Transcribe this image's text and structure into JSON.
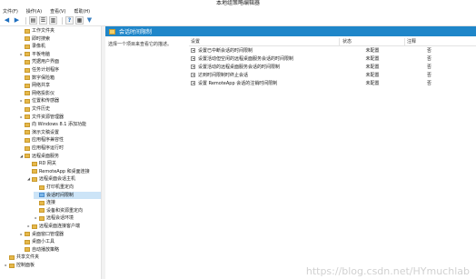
{
  "window": {
    "title": "本地组策略编辑器"
  },
  "menu": [
    "文件(F)",
    "操作(A)",
    "查看(V)",
    "帮助(H)"
  ],
  "tree": [
    {
      "label": "工作文件夹",
      "level": 0,
      "expander": ""
    },
    {
      "label": "即时搜索",
      "level": 0,
      "expander": ""
    },
    {
      "label": "录像机",
      "level": 0,
      "expander": ""
    },
    {
      "label": "平板电脑",
      "level": 0,
      "expander": "▸"
    },
    {
      "label": "凭据用户界面",
      "level": 0,
      "expander": ""
    },
    {
      "label": "任务计划程序",
      "level": 0,
      "expander": ""
    },
    {
      "label": "数字保险箱",
      "level": 0,
      "expander": ""
    },
    {
      "label": "网络共享",
      "level": 0,
      "expander": ""
    },
    {
      "label": "网络投影仪",
      "level": 0,
      "expander": ""
    },
    {
      "label": "位置和传感器",
      "level": 0,
      "expander": "▸"
    },
    {
      "label": "文件历史",
      "level": 0,
      "expander": ""
    },
    {
      "label": "文件资源管理器",
      "level": 0,
      "expander": "▸"
    },
    {
      "label": "向 Windows 8.1 添加功能",
      "level": 0,
      "expander": ""
    },
    {
      "label": "演示文稿设置",
      "level": 0,
      "expander": ""
    },
    {
      "label": "应用程序兼容性",
      "level": 0,
      "expander": ""
    },
    {
      "label": "应用程序运行时",
      "level": 0,
      "expander": ""
    },
    {
      "label": "远程桌面服务",
      "level": 0,
      "expander": "◢"
    },
    {
      "label": "RD 网关",
      "level": 1,
      "expander": ""
    },
    {
      "label": "RemoteApp 和桌面连接",
      "level": 1,
      "expander": ""
    },
    {
      "label": "远程桌面会话主机",
      "level": 1,
      "expander": "◢"
    },
    {
      "label": "打印机重定向",
      "level": 2,
      "expander": ""
    },
    {
      "label": "会话时间限制",
      "level": 2,
      "expander": "",
      "selected": true
    },
    {
      "label": "连接",
      "level": 2,
      "expander": ""
    },
    {
      "label": "设备和资源重定向",
      "level": 2,
      "expander": ""
    },
    {
      "label": "远程会话环境",
      "level": 2,
      "expander": "▸"
    },
    {
      "label": "远程桌面连接客户端",
      "level": 1,
      "expander": "▸"
    },
    {
      "label": "桌面窗口管理器",
      "level": 0,
      "expander": "▸"
    },
    {
      "label": "桌面小工具",
      "level": 0,
      "expander": ""
    },
    {
      "label": "自动播放策略",
      "level": 0,
      "expander": ""
    },
    {
      "label": "共享文件夹",
      "level": -1,
      "expander": ""
    },
    {
      "label": "控制面板",
      "level": -1,
      "expander": "▸"
    }
  ],
  "pane": {
    "header": "会话时间限制",
    "description": "选择一个项目来查看它的描述。",
    "columns": {
      "setting": "设置",
      "state": "状态",
      "comment": "注释"
    },
    "rows": [
      {
        "setting": "设置已中断会话的时间限制",
        "state": "未配置",
        "comment": "否"
      },
      {
        "setting": "设置活动但空闲的远程桌面服务会话的时间限制",
        "state": "未配置",
        "comment": "否"
      },
      {
        "setting": "设置活动的远程桌面服务会话的时间限制",
        "state": "未配置",
        "comment": "否"
      },
      {
        "setting": "达到时间限制时终止会话",
        "state": "未配置",
        "comment": "否"
      },
      {
        "setting": "设置 RemoteApp 会话的注销时间限制",
        "state": "未配置",
        "comment": "否"
      }
    ]
  },
  "watermark": "https://blog.csdn.net/HYmuchlab"
}
